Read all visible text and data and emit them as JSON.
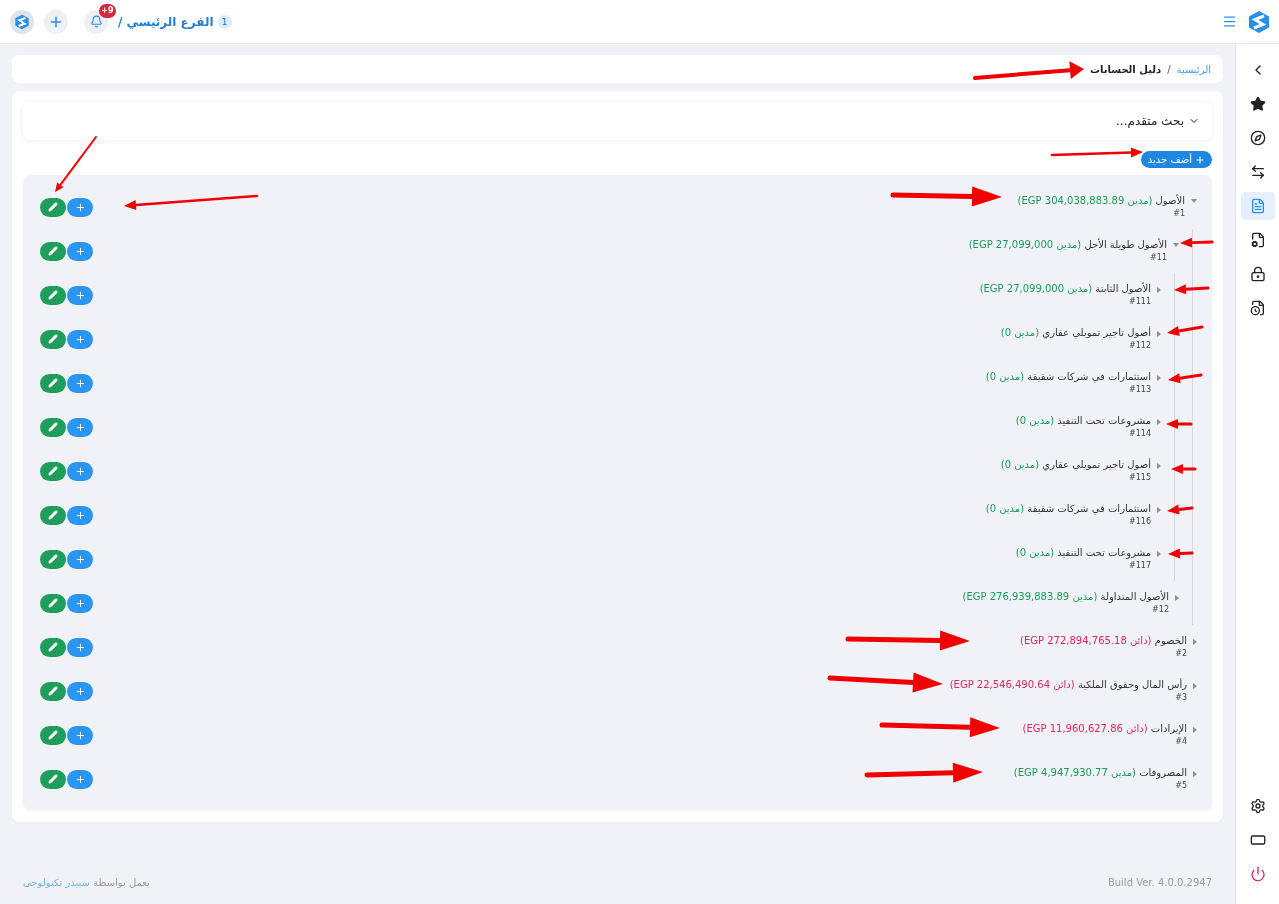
{
  "topbar": {
    "branch_number": "1",
    "branch_name": "الفرع الرئيسي /",
    "notification_count": "+9"
  },
  "sidebar": {
    "items": [
      {
        "kind": "back",
        "selected": false
      },
      {
        "kind": "star",
        "selected": false
      },
      {
        "kind": "compass",
        "selected": false
      },
      {
        "kind": "transfer",
        "selected": false
      },
      {
        "kind": "accounts",
        "selected": true
      },
      {
        "kind": "file-settings",
        "selected": false
      },
      {
        "kind": "lock-clock",
        "selected": false
      },
      {
        "kind": "report",
        "selected": false
      }
    ],
    "bottom": [
      {
        "kind": "settings"
      },
      {
        "kind": "screen"
      },
      {
        "kind": "power"
      }
    ]
  },
  "breadcrumb": {
    "home": "الرئيسية",
    "separator": "/",
    "current": "دليل الحسابات"
  },
  "advanced_search": {
    "label": "بحث متقدم...",
    "expanded": false
  },
  "add_button": "أضف جديد",
  "accounts": [
    {
      "name": "الأصول",
      "balance": "(مدين EGP 304,038,883.89)",
      "kind": "debit",
      "code": "#1",
      "expanded": true,
      "children": [
        {
          "name": "الأصول طويلة الأجل",
          "balance": "(مدين EGP 27,099,000)",
          "kind": "debit",
          "code": "#11",
          "expanded": true,
          "children": [
            {
              "name": "الأصول الثابتة",
              "balance": "(مدين EGP 27,099,000)",
              "kind": "debit",
              "code": "#111",
              "expanded": false
            },
            {
              "name": "أصول تاجير تمويلي عقاري",
              "balance": "(مدين 0)",
              "kind": "debit",
              "code": "#112",
              "expanded": false
            },
            {
              "name": "استثمارات في شركات شقيقة",
              "balance": "(مدين 0)",
              "kind": "debit",
              "code": "#113",
              "expanded": false
            },
            {
              "name": "مشروعات تحت التنفيذ",
              "balance": "(مدين 0)",
              "kind": "debit",
              "code": "#114",
              "expanded": false
            },
            {
              "name": "أصول تاجير تمويلي عقاري",
              "balance": "(مدين 0)",
              "kind": "debit",
              "code": "#115",
              "expanded": false
            },
            {
              "name": "استثمارات في شركات شقيقة",
              "balance": "(مدين 0)",
              "kind": "debit",
              "code": "#116",
              "expanded": false
            },
            {
              "name": "مشروعات تحت التنفيذ",
              "balance": "(مدين 0)",
              "kind": "debit",
              "code": "#117",
              "expanded": false
            }
          ]
        },
        {
          "name": "الأصول المتداولة",
          "balance": "(مدين EGP 276,939,883.89)",
          "kind": "debit",
          "code": "#12",
          "expanded": false
        }
      ]
    },
    {
      "name": "الخصوم",
      "balance": "(دائن EGP 272,894,765.18)",
      "kind": "credit",
      "code": "#2",
      "expanded": false
    },
    {
      "name": "رأس المال وحقوق الملكية",
      "balance": "(دائن EGP 22,546,490.64)",
      "kind": "credit",
      "code": "#3",
      "expanded": false
    },
    {
      "name": "الإيرادات",
      "balance": "(دائن EGP 11,960,627.86)",
      "kind": "credit",
      "code": "#4",
      "expanded": false
    },
    {
      "name": "المصروفات",
      "balance": "(مدين EGP 4,947,930.77)",
      "kind": "debit",
      "code": "#5",
      "expanded": false
    }
  ],
  "footer": {
    "powered_by": "يعمل بواسطة",
    "company": "سبيدر تكنولوجى",
    "build": "Build Ver. 4.0.0.2947"
  }
}
